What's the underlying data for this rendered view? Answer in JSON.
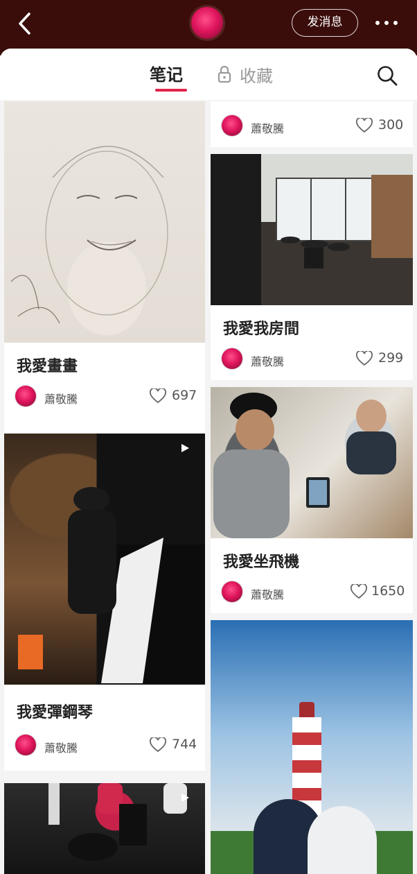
{
  "header": {
    "message_button_label": "发消息"
  },
  "tabs": {
    "notes_label": "笔记",
    "favorites_label": "收藏"
  },
  "left_column": [
    {
      "title": "我愛畫畫",
      "author": "蕭敬騰",
      "likes": "697",
      "video": false,
      "image": "sketch-portrait"
    },
    {
      "title": "我愛彈鋼琴",
      "author": "蕭敬騰",
      "likes": "744",
      "video": true,
      "image": "piano"
    },
    {
      "title": "",
      "author": "",
      "likes": "",
      "video": true,
      "image": "studio"
    }
  ],
  "right_column": [
    {
      "title": "",
      "author": "蕭敬騰",
      "likes": "300",
      "video": false,
      "image": ""
    },
    {
      "title": "我愛我房間",
      "author": "蕭敬騰",
      "likes": "299",
      "video": false,
      "image": "drum-room"
    },
    {
      "title": "我愛坐飛機",
      "author": "蕭敬騰",
      "likes": "1650",
      "video": false,
      "image": "airplane-selfie"
    },
    {
      "title": "",
      "author": "",
      "likes": "",
      "video": false,
      "image": "lighthouse"
    }
  ],
  "colors": {
    "header_bg": "#3a0d0b",
    "accent": "#e2244b",
    "page_bg": "#f4f4f4"
  }
}
